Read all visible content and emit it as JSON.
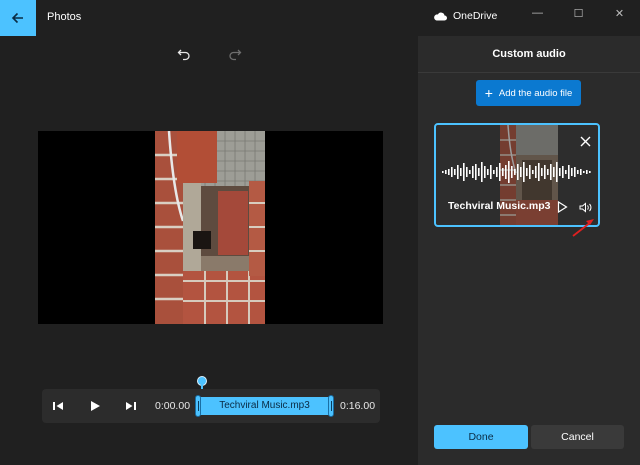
{
  "app": {
    "title": "Photos",
    "onedrive_label": "OneDrive",
    "accent": "#4cc2ff",
    "icon": "back-arrow-icon"
  },
  "window_controls": [
    {
      "name": "minimize",
      "glyph": "—"
    },
    {
      "name": "maximize",
      "glyph": "☐"
    },
    {
      "name": "close",
      "glyph": "✕"
    }
  ],
  "toolbar": {
    "undo_icon": "undo-icon",
    "redo_icon": "redo-icon"
  },
  "playback": {
    "current_time": "0:00.00",
    "end_time": "0:16.00",
    "audio_track_label": "Techviral Music.mp3",
    "controls": [
      "skip-back-icon",
      "play-icon",
      "skip-forward-icon"
    ]
  },
  "panel": {
    "title": "Custom audio",
    "add_button_label": "Add the audio file",
    "audio_card": {
      "file_name": "Techviral Music.mp3",
      "icons": [
        "close-icon",
        "play-icon",
        "volume-icon"
      ]
    },
    "done_label": "Done",
    "cancel_label": "Cancel"
  }
}
